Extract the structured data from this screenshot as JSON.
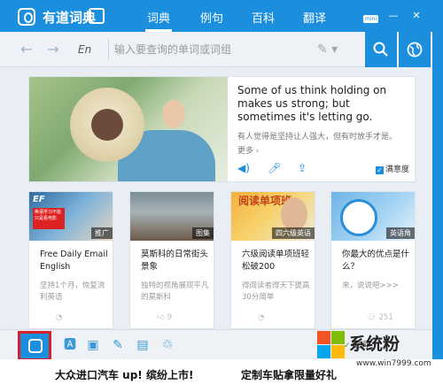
{
  "titlebar": {
    "app_title": "有道词典",
    "tabs": [
      {
        "label": "词典"
      },
      {
        "label": "例句"
      },
      {
        "label": "百科"
      },
      {
        "label": "翻译"
      }
    ],
    "mini_label": "mini",
    "min_symbol": "—",
    "close_symbol": "✕"
  },
  "search": {
    "lang": "En",
    "placeholder": "输入要查询的单词或词组"
  },
  "hero": {
    "quote": "Some of us think holding on makes us strong; but sometimes it's letting go.",
    "translation": "有人觉得是坚持让人强大，但有时放手才是。",
    "more_label": "更多",
    "more_arrow": "›",
    "satisfy_label": "满意度"
  },
  "cards": [
    {
      "tag": "推广",
      "title": "Free Daily Email English",
      "desc": "坚持1个月，恢复流利英语",
      "meta": "",
      "img_text": "EF",
      "img_sub": "英语学习不能只是看电影"
    },
    {
      "tag": "图集",
      "title": "莫斯科的日常街头景象",
      "desc": "独特的视角展现平凡的莫斯科",
      "meta": "9",
      "img_text": "",
      "img_sub": ""
    },
    {
      "tag": "四六级英语",
      "title": "六级阅读单项班轻松破200",
      "desc": "得阅读者得天下提高30分简单",
      "meta": "",
      "img_text": "阅读单项班",
      "img_sub": ""
    },
    {
      "tag": "英语角",
      "title": "你最大的优点是什么？",
      "desc": "来，说说吧>>>",
      "meta": "251",
      "img_text": "",
      "img_sub": ""
    }
  ],
  "toolbar": {
    "status": "取词"
  },
  "ads": {
    "ad1": "大众进口汽车 up! 缤纷上市!",
    "ad2": "定制车贴拿限量好礼"
  },
  "watermark": {
    "title": "系统粉",
    "url": "www.win7999.com"
  },
  "colors": {
    "accent": "#1b8fdd",
    "highlight_border": "#d2232a"
  }
}
